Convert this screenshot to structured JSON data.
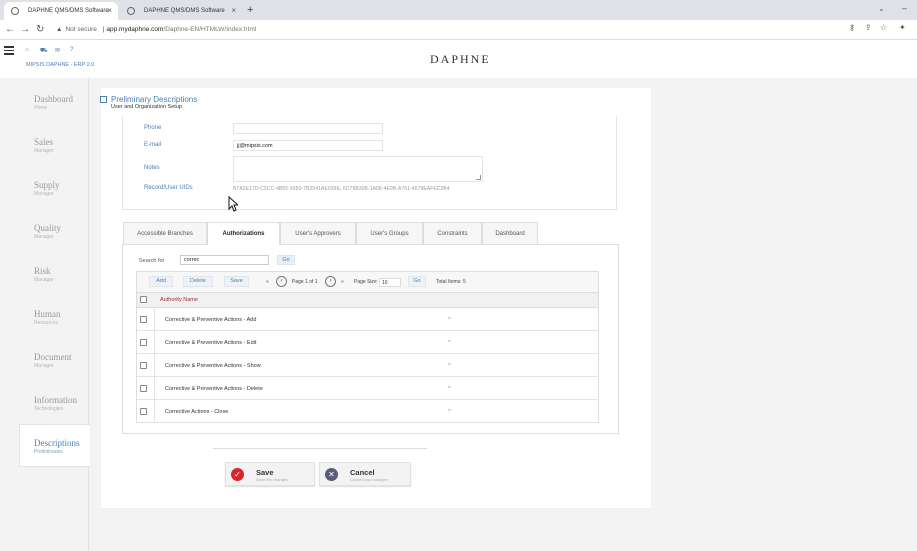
{
  "browser": {
    "tabs": [
      {
        "title": "DAPHNE QMS/DMS Software",
        "close": "×"
      },
      {
        "title": "DAPHNE QMS/DMS Software",
        "close": "×"
      }
    ],
    "new_tab": "+",
    "security": "Not secure",
    "url_host": "app.mydaphne.com",
    "url_path": "/Daphne-EN/HTMLW/Index.html"
  },
  "app": {
    "logo": "DAPHNE",
    "brand_sub": "MIPSIS DAPHNE - ERP 2.0"
  },
  "sidebar": {
    "items": [
      {
        "title": "Dashboard",
        "sub": "Home"
      },
      {
        "title": "Sales",
        "sub": "Manager"
      },
      {
        "title": "Supply",
        "sub": "Manager"
      },
      {
        "title": "Quality",
        "sub": "Manager"
      },
      {
        "title": "Risk",
        "sub": "Manager"
      },
      {
        "title": "Human",
        "sub": "Resources"
      },
      {
        "title": "Document",
        "sub": "Manager"
      },
      {
        "title": "Information",
        "sub": "Technologies"
      },
      {
        "title": "Descriptions",
        "sub": "Preliminaries"
      }
    ]
  },
  "page": {
    "title": "Preliminary Descriptions",
    "subtitle": "User and Organization Setup"
  },
  "form": {
    "phone_label": "Phone",
    "phone_value": "",
    "email_label": "E-mail",
    "email_value": "jj@mipsis.com",
    "notes_label": "Notes",
    "guids_label": "Record/User UIDs",
    "guids_value": "B7A2E17D-C5CC-4B55-9350-7B2541AE039E,  6C79B30B-1A08-4E9B-A761-4679EAFEC3B4"
  },
  "tabs": [
    {
      "label": "Accessible Branches"
    },
    {
      "label": "Authorizations"
    },
    {
      "label": "User's Approvers"
    },
    {
      "label": "User's Groups"
    },
    {
      "label": "Constraints"
    },
    {
      "label": "Dashboard"
    }
  ],
  "search": {
    "label": "Search for",
    "value": "correc",
    "go": "Go"
  },
  "grid": {
    "add": "Add",
    "delete": "Delete",
    "save": "Save",
    "first": "«",
    "prev": "‹",
    "page_info": "Page 1 of 1",
    "next": "›",
    "last": "»",
    "page_size_label": "Page Size",
    "page_size": "10",
    "go": "Go",
    "total": "Total Items: 5",
    "column": "Authority Name",
    "rows": [
      "Corrective & Preventive Actions - Add",
      "Corrective & Preventive Actions - Edit",
      "Corrective & Preventive Actions - Show",
      "Corrective & Preventive Actions - Delete",
      "Corrective Actions - Close"
    ],
    "caret": "^"
  },
  "actions": {
    "save_label": "Save",
    "save_sub": "Save the changes",
    "cancel_label": "Cancel",
    "cancel_sub": "Cancel your changes"
  },
  "colors": {
    "accent": "#4a7fb7",
    "save_icon": "#d9262c",
    "cancel_icon": "#5a5a7a",
    "column_header": "#a03030"
  },
  "icons": [
    "site-info-icon",
    "back-arrow-icon",
    "forward-arrow-icon",
    "reload-icon",
    "warning-icon",
    "key-icon",
    "share-icon",
    "star-icon",
    "extensions-icon",
    "hamburger-icon",
    "home-icon",
    "cart-icon",
    "mail-icon",
    "help-icon",
    "page-icon",
    "checkmark-icon",
    "cancel-x-icon",
    "mouse-cursor-icon"
  ]
}
